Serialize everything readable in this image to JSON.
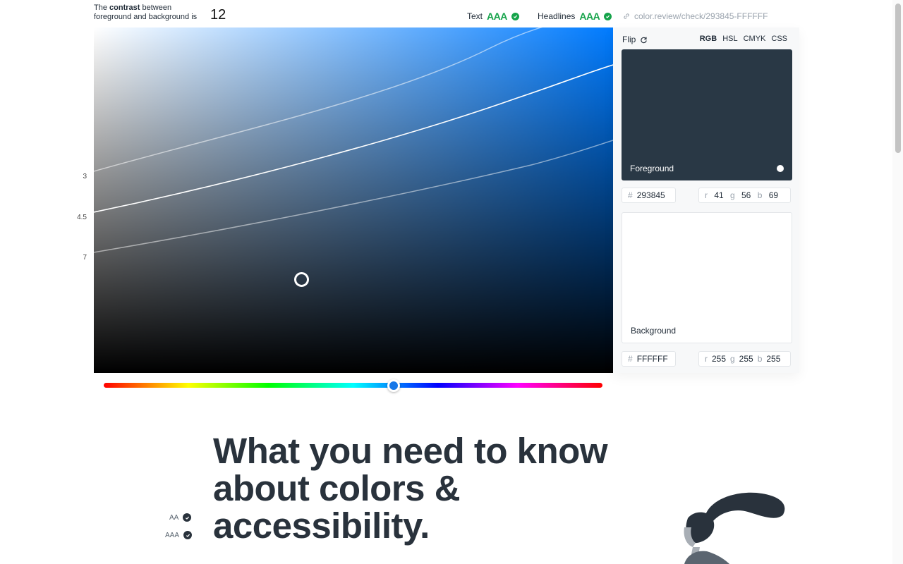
{
  "summary": {
    "line1_pre": "The ",
    "line1_bold": "contrast",
    "line1_post": " between",
    "line2": "foreground and background is",
    "ratio": "12"
  },
  "badges": [
    {
      "label": "Text",
      "level": "AAA"
    },
    {
      "label": "Headlines",
      "level": "AAA"
    }
  ],
  "share_link": "color.review/check/293845-FFFFFF",
  "canvas": {
    "y_labels": [
      "3",
      "4.5",
      "7"
    ],
    "hue_color": "#007bff"
  },
  "panel": {
    "flip_label": "Flip",
    "modes": [
      "RGB",
      "HSL",
      "CMYK",
      "CSS"
    ],
    "active_mode": "RGB",
    "foreground": {
      "label": "Foreground",
      "hex": "293845",
      "r": "41",
      "g": "56",
      "b": "69",
      "color": "#293845"
    },
    "background": {
      "label": "Background",
      "hex": "FFFFFF",
      "r": "255",
      "g": "255",
      "b": "255",
      "color": "#ffffff"
    },
    "hash": "#",
    "r_key": "r",
    "g_key": "g",
    "b_key": "b"
  },
  "legend": {
    "aa": "AA",
    "aaa": "AAA"
  },
  "article": {
    "headline": "What you need to know about colors & accessibility."
  },
  "colors": {
    "pass": "#15a34a",
    "ink": "#29323c"
  }
}
